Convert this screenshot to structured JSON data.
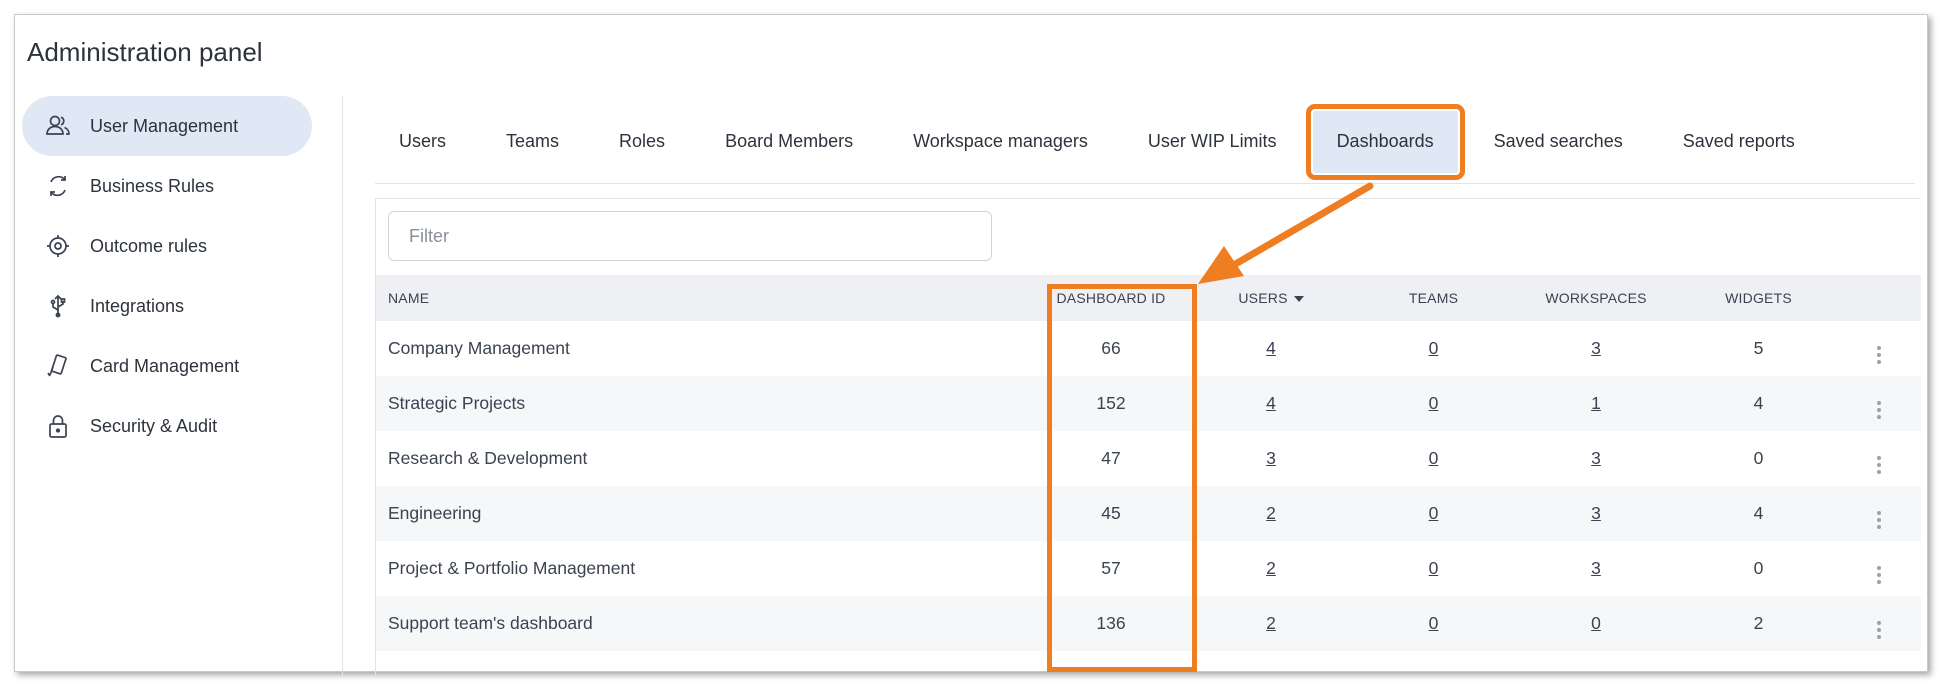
{
  "page": {
    "title": "Administration panel"
  },
  "sidebar": {
    "items": [
      {
        "label": "User Management",
        "icon": "users-icon",
        "active": true
      },
      {
        "label": "Business Rules",
        "icon": "refresh-icon",
        "active": false
      },
      {
        "label": "Outcome rules",
        "icon": "target-icon",
        "active": false
      },
      {
        "label": "Integrations",
        "icon": "usb-icon",
        "active": false
      },
      {
        "label": "Card Management",
        "icon": "cards-icon",
        "active": false
      },
      {
        "label": "Security & Audit",
        "icon": "lock-icon",
        "active": false
      }
    ]
  },
  "tabs": [
    {
      "label": "Users"
    },
    {
      "label": "Teams"
    },
    {
      "label": "Roles"
    },
    {
      "label": "Board Members"
    },
    {
      "label": "Workspace managers"
    },
    {
      "label": "User WIP Limits"
    },
    {
      "label": "Dashboards",
      "active": true
    },
    {
      "label": "Saved searches"
    },
    {
      "label": "Saved reports"
    }
  ],
  "filter": {
    "placeholder": "Filter",
    "value": ""
  },
  "table": {
    "columns": [
      "NAME",
      "DASHBOARD ID",
      "USERS",
      "TEAMS",
      "WORKSPACES",
      "WIDGETS"
    ],
    "rows": [
      {
        "name": "Company Management",
        "id": "66",
        "users": "4",
        "teams": "0",
        "workspaces": "3",
        "widgets": "5"
      },
      {
        "name": "Strategic Projects",
        "id": "152",
        "users": "4",
        "teams": "0",
        "workspaces": "1",
        "widgets": "4"
      },
      {
        "name": "Research & Development",
        "id": "47",
        "users": "3",
        "teams": "0",
        "workspaces": "3",
        "widgets": "0"
      },
      {
        "name": "Engineering",
        "id": "45",
        "users": "2",
        "teams": "0",
        "workspaces": "3",
        "widgets": "4"
      },
      {
        "name": "Project & Portfolio Management",
        "id": "57",
        "users": "2",
        "teams": "0",
        "workspaces": "3",
        "widgets": "0"
      },
      {
        "name": "Support team's dashboard",
        "id": "136",
        "users": "2",
        "teams": "0",
        "workspaces": "0",
        "widgets": "2"
      }
    ]
  },
  "colors": {
    "highlight": "#ef7d21",
    "active_bg": "#dfe8f4"
  }
}
